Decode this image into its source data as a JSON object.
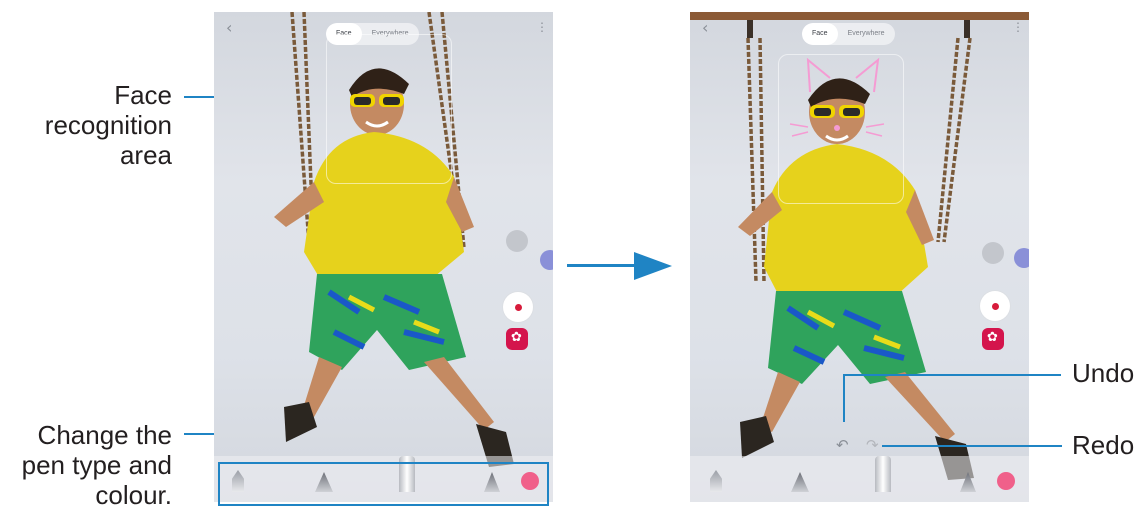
{
  "labels": {
    "face_area": [
      "Face",
      "recognition",
      "area"
    ],
    "pen": [
      "Change the",
      "pen type and",
      "colour."
    ],
    "undo": "Undo",
    "redo": "Redo"
  },
  "screen": {
    "mode_tabs": [
      "Face",
      "Everywhere"
    ],
    "back_icon": "‹",
    "more_icon": "⋮",
    "undo_icon": "↶",
    "redo_icon": "↷"
  },
  "colors": {
    "accent_line": "#1f84c4",
    "record": "#d71b3b",
    "sticker": "#d4144c",
    "pen_color": "#f0608a",
    "pen_icon": "#8a90d8"
  }
}
